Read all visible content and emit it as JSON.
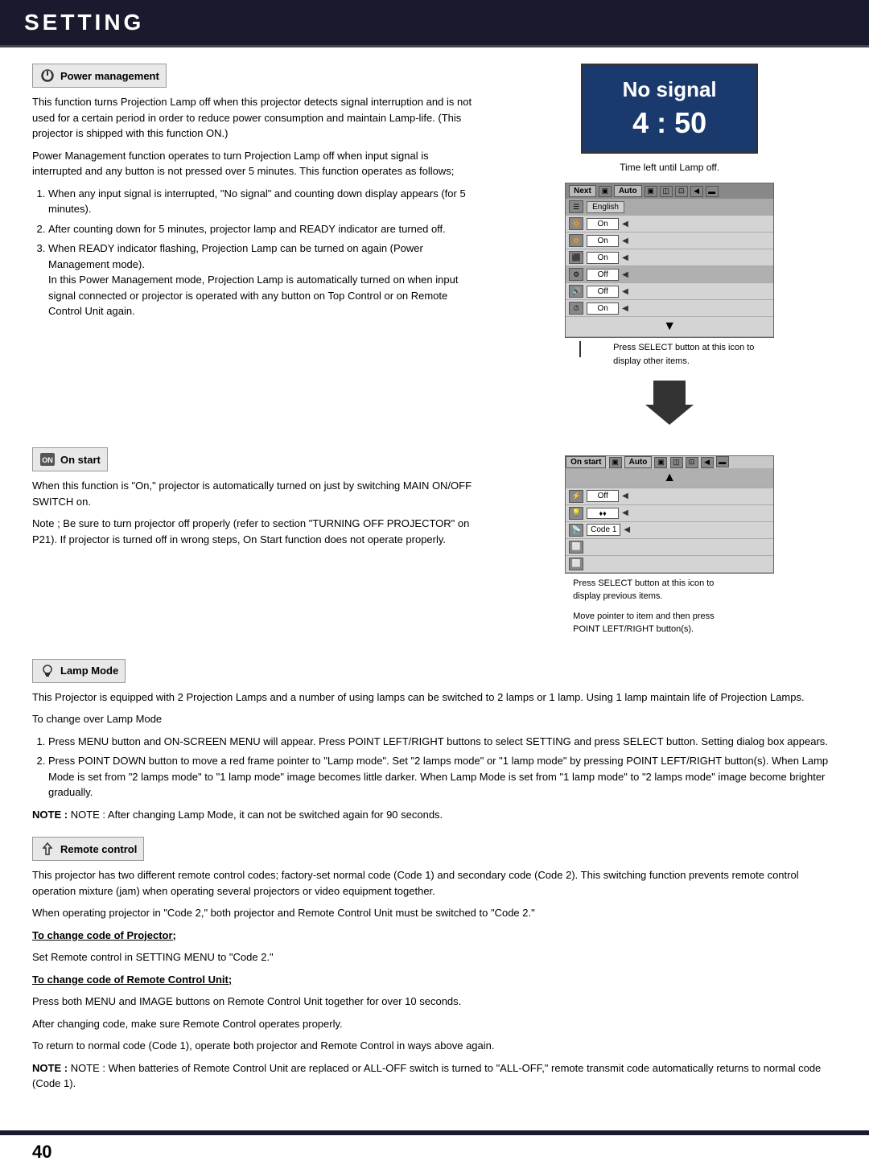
{
  "header": {
    "title": "SETTING"
  },
  "page_number": "40",
  "power_management": {
    "section_label": "Power management",
    "para1": "This function turns Projection Lamp off when this projector detects signal interruption and is not used for a certain period in order to reduce power consumption and maintain Lamp-life.  (This projector is shipped with this function ON.)",
    "para2": "Power Management function operates to turn Projection Lamp off when input signal is interrupted and any button is not pressed over 5 minutes.  This function operates as follows;",
    "items": [
      "When any input signal is interrupted, \"No signal\" and counting down display appears (for 5 minutes).",
      "After counting down for 5 minutes, projector lamp and READY indicator are turned off.",
      "When READY indicator flashing, Projection Lamp can be turned on again (Power Management mode).\nIn this Power Management mode, Projection Lamp is automatically turned on when input signal connected or projector is operated with any button on Top Control or on Remote Control Unit again."
    ]
  },
  "no_signal": {
    "title": "No signal",
    "timer": "4 : 50",
    "lamp_off_text": "Time left until Lamp off."
  },
  "menu_ui": {
    "next_btn": "Next",
    "auto_btn": "Auto",
    "english_value": "English",
    "on_value": "On",
    "off_value": "Off",
    "rows": [
      {
        "value": "English",
        "type": "lang"
      },
      {
        "value": "On"
      },
      {
        "value": "On"
      },
      {
        "value": "On"
      },
      {
        "value": "Off"
      },
      {
        "value": "Off"
      },
      {
        "value": "On"
      }
    ],
    "annotation1": "Press SELECT button at this icon to display other items."
  },
  "on_start": {
    "section_label": "On start",
    "para1": "When this function is \"On,\" projector is automatically turned on just by switching MAIN ON/OFF SWITCH on.",
    "note": "Note ; Be sure to turn projector off properly (refer to section \"TURNING OFF PROJECTOR\" on P21).  If projector is turned off in wrong steps, On Start function does not operate properly.",
    "menu_bar_label": "On start",
    "annotation2": "Press SELECT button at this icon to display previous items.",
    "annotation3": "Move pointer to item and then press POINT LEFT/RIGHT button(s).",
    "off_value": "Off",
    "code_value": "Code 1"
  },
  "lamp_mode": {
    "section_label": "Lamp Mode",
    "para1": "This Projector is equipped with 2 Projection Lamps and a number of using lamps can be switched to 2 lamps or 1 lamp. Using 1 lamp maintain life of Projection Lamps.",
    "change_label": "To change over Lamp Mode",
    "steps": [
      "Press MENU button and ON-SCREEN MENU will appear.  Press POINT LEFT/RIGHT buttons to select SETTING and press SELECT button.  Setting dialog box appears.",
      "Press POINT DOWN button to move a red frame pointer to \"Lamp mode\".  Set \"2 lamps mode\" or \"1 lamp mode\" by pressing POINT LEFT/RIGHT button(s).  When Lamp Mode is set from \"2 lamps mode\" to \"1 lamp mode\" image becomes little darker.  When Lamp Mode is set from \"1 lamp mode\" to \"2 lamps mode\" image become brighter gradually."
    ],
    "note": "NOTE : After changing Lamp Mode, it can not be switched again for 90 seconds."
  },
  "remote_control": {
    "section_label": "Remote control",
    "para1": "This projector has two different remote control codes; factory-set normal code (Code 1) and secondary code (Code 2). This switching function prevents remote control operation mixture (jam) when operating several projectors or video equipment together.",
    "para2": "When operating projector in \"Code 2,\"  both projector and Remote Control Unit must be switched to \"Code 2.\"",
    "change_projector_label": "To change code of Projector;",
    "change_projector_text": "Set Remote control in SETTING MENU to \"Code 2.\"",
    "change_remote_label": "To change code of Remote Control Unit;",
    "change_remote_text": "Press both MENU and IMAGE buttons on Remote Control Unit together for over 10 seconds.",
    "after_change": "After changing code, make sure Remote Control operates properly.",
    "return_text": "To return to normal code (Code 1), operate both projector and Remote Control in ways above again.",
    "note": "NOTE : When batteries of Remote Control Unit are replaced or ALL-OFF switch is turned to \"ALL-OFF,\"  remote transmit code automatically returns to normal code (Code 1)."
  }
}
